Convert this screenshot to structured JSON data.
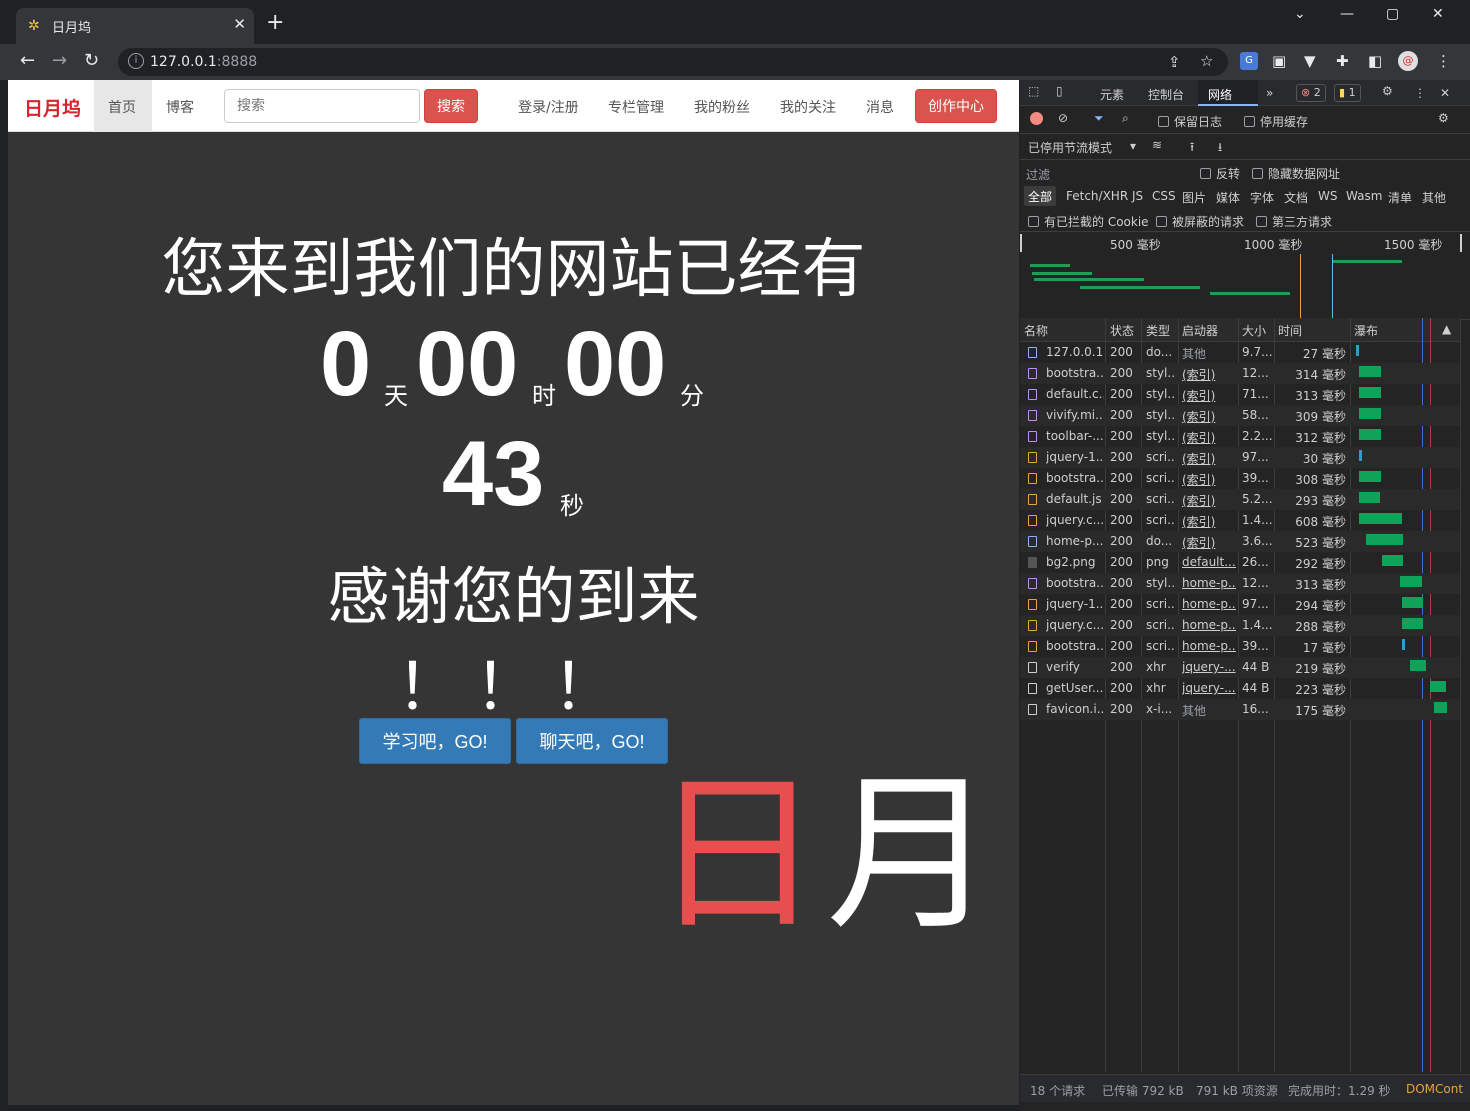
{
  "browser": {
    "tab_title": "日月坞",
    "url_host": "127.0.0.1",
    "url_port": ":8888"
  },
  "site": {
    "brand": "日月坞",
    "nav": {
      "home": "首页",
      "blog": "博客",
      "search_placeholder": "搜索",
      "search_button": "搜索",
      "login": "登录/注册",
      "column": "专栏管理",
      "fans": "我的粉丝",
      "follow": "我的关注",
      "messages": "消息",
      "create": "创作中心"
    },
    "welcome": "您来到我们的网站已经有",
    "counter": {
      "days": "0",
      "days_unit": "天",
      "hours": "00",
      "hours_unit": "时",
      "minutes": "00",
      "minutes_unit": "分",
      "seconds": "43",
      "seconds_unit": "秒"
    },
    "thanks": "感谢您的到来",
    "bangs": "！！！",
    "buttons": {
      "study": "学习吧，GO!",
      "chat": "聊天吧，GO!"
    },
    "big_ri": "日",
    "big_yue": "月"
  },
  "devtools": {
    "tabs": {
      "elements": "元素",
      "console": "控制台",
      "network": "网络"
    },
    "errors": "2",
    "warnings": "1",
    "preserve_log": "保留日志",
    "disable_cache": "停用缓存",
    "throttling": "已停用节流模式",
    "filter_placeholder": "过滤",
    "invert": "反转",
    "hide_data_urls": "隐藏数据网址",
    "type_filters": [
      "全部",
      "Fetch/XHR",
      "JS",
      "CSS",
      "图片",
      "媒体",
      "字体",
      "文档",
      "WS",
      "Wasm",
      "清单",
      "其他"
    ],
    "blocked_cookies": "有已拦截的 Cookie",
    "blocked_requests": "被屏蔽的请求",
    "third_party": "第三方请求",
    "ticks": [
      "500 毫秒",
      "1000 毫秒",
      "1500 毫秒"
    ],
    "columns": [
      "名称",
      "状态",
      "类型",
      "启动器",
      "大小",
      "时间",
      "瀑布"
    ],
    "requests": [
      {
        "name": "127.0.0.1",
        "status": "200",
        "type": "do...",
        "initiator": "其他",
        "size": "9.7...",
        "time": "27 毫秒",
        "kind": "doc",
        "link": false
      },
      {
        "name": "bootstra...",
        "status": "200",
        "type": "styl...",
        "initiator": "(索引)",
        "size": "12...",
        "time": "314 毫秒",
        "kind": "css",
        "link": true
      },
      {
        "name": "default.c...",
        "status": "200",
        "type": "styl...",
        "initiator": "(索引)",
        "size": "71...",
        "time": "313 毫秒",
        "kind": "css",
        "link": true
      },
      {
        "name": "vivify.mi...",
        "status": "200",
        "type": "styl...",
        "initiator": "(索引)",
        "size": "58...",
        "time": "309 毫秒",
        "kind": "css",
        "link": true
      },
      {
        "name": "toolbar-...",
        "status": "200",
        "type": "styl...",
        "initiator": "(索引)",
        "size": "2.2...",
        "time": "312 毫秒",
        "kind": "css",
        "link": true
      },
      {
        "name": "jquery-1...",
        "status": "200",
        "type": "scri...",
        "initiator": "(索引)",
        "size": "97...",
        "time": "30 毫秒",
        "kind": "js",
        "link": true
      },
      {
        "name": "bootstra...",
        "status": "200",
        "type": "scri...",
        "initiator": "(索引)",
        "size": "39...",
        "time": "308 毫秒",
        "kind": "js",
        "link": true
      },
      {
        "name": "default.js",
        "status": "200",
        "type": "scri...",
        "initiator": "(索引)",
        "size": "5.2...",
        "time": "293 毫秒",
        "kind": "js",
        "link": true
      },
      {
        "name": "jquery.c...",
        "status": "200",
        "type": "scri...",
        "initiator": "(索引)",
        "size": "1.4...",
        "time": "608 毫秒",
        "kind": "js",
        "link": true
      },
      {
        "name": "home-p...",
        "status": "200",
        "type": "do...",
        "initiator": "(索引)",
        "size": "3.6...",
        "time": "523 毫秒",
        "kind": "doc",
        "link": true
      },
      {
        "name": "bg2.png",
        "status": "200",
        "type": "png",
        "initiator": "default....",
        "size": "26...",
        "time": "292 毫秒",
        "kind": "img",
        "link": true
      },
      {
        "name": "bootstra...",
        "status": "200",
        "type": "styl...",
        "initiator": "home-p...",
        "size": "12...",
        "time": "313 毫秒",
        "kind": "css",
        "link": true
      },
      {
        "name": "jquery-1...",
        "status": "200",
        "type": "scri...",
        "initiator": "home-p...",
        "size": "97...",
        "time": "294 毫秒",
        "kind": "js",
        "link": true
      },
      {
        "name": "jquery.c...",
        "status": "200",
        "type": "scri...",
        "initiator": "home-p...",
        "size": "1.4...",
        "time": "288 毫秒",
        "kind": "js",
        "link": true
      },
      {
        "name": "bootstra...",
        "status": "200",
        "type": "scri...",
        "initiator": "home-p...",
        "size": "39...",
        "time": "17 毫秒",
        "kind": "js",
        "link": true
      },
      {
        "name": "verify",
        "status": "200",
        "type": "xhr",
        "initiator": "jquery-...",
        "size": "44 B",
        "time": "219 毫秒",
        "kind": "xhr",
        "link": true
      },
      {
        "name": "getUser...",
        "status": "200",
        "type": "xhr",
        "initiator": "jquery-...",
        "size": "44 B",
        "time": "223 毫秒",
        "kind": "xhr",
        "link": true
      },
      {
        "name": "favicon.i...",
        "status": "200",
        "type": "x-i...",
        "initiator": "其他",
        "size": "16...",
        "time": "175 毫秒",
        "kind": "other",
        "link": false
      }
    ],
    "footer": {
      "requests": "18 个请求",
      "transferred": "已传输 792 kB",
      "resources": "791 kB 项资源",
      "finish": "完成用时：1.29 秒",
      "domcont": "DOMCont"
    }
  }
}
